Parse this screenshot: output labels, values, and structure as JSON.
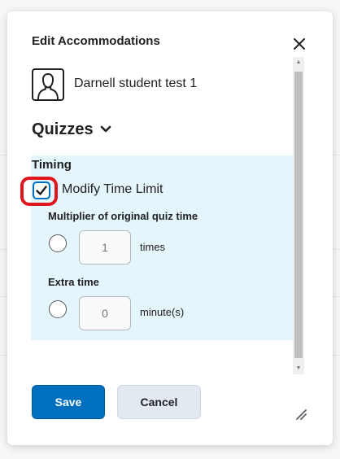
{
  "dialog": {
    "title": "Edit Accommodations",
    "close_icon": "close-icon"
  },
  "student": {
    "avatar_icon": "user-avatar-icon",
    "name": "Darnell student test 1"
  },
  "section": {
    "title": "Quizzes",
    "toggle_icon": "chevron-down-icon"
  },
  "timing": {
    "heading": "Timing",
    "modify_time_limit": {
      "label": "Modify Time Limit",
      "checked": true,
      "check_icon": "checkmark-icon"
    },
    "multiplier": {
      "label": "Multiplier of original quiz time",
      "placeholder": "1",
      "unit": "times",
      "selected": false
    },
    "extra_time": {
      "label": "Extra time",
      "placeholder": "0",
      "unit": "minute(s)",
      "selected": false
    }
  },
  "actions": {
    "save_label": "Save",
    "cancel_label": "Cancel"
  },
  "colors": {
    "primary": "#006fbf",
    "panel_background": "#e5f5fc",
    "highlight": "#e0161f"
  }
}
